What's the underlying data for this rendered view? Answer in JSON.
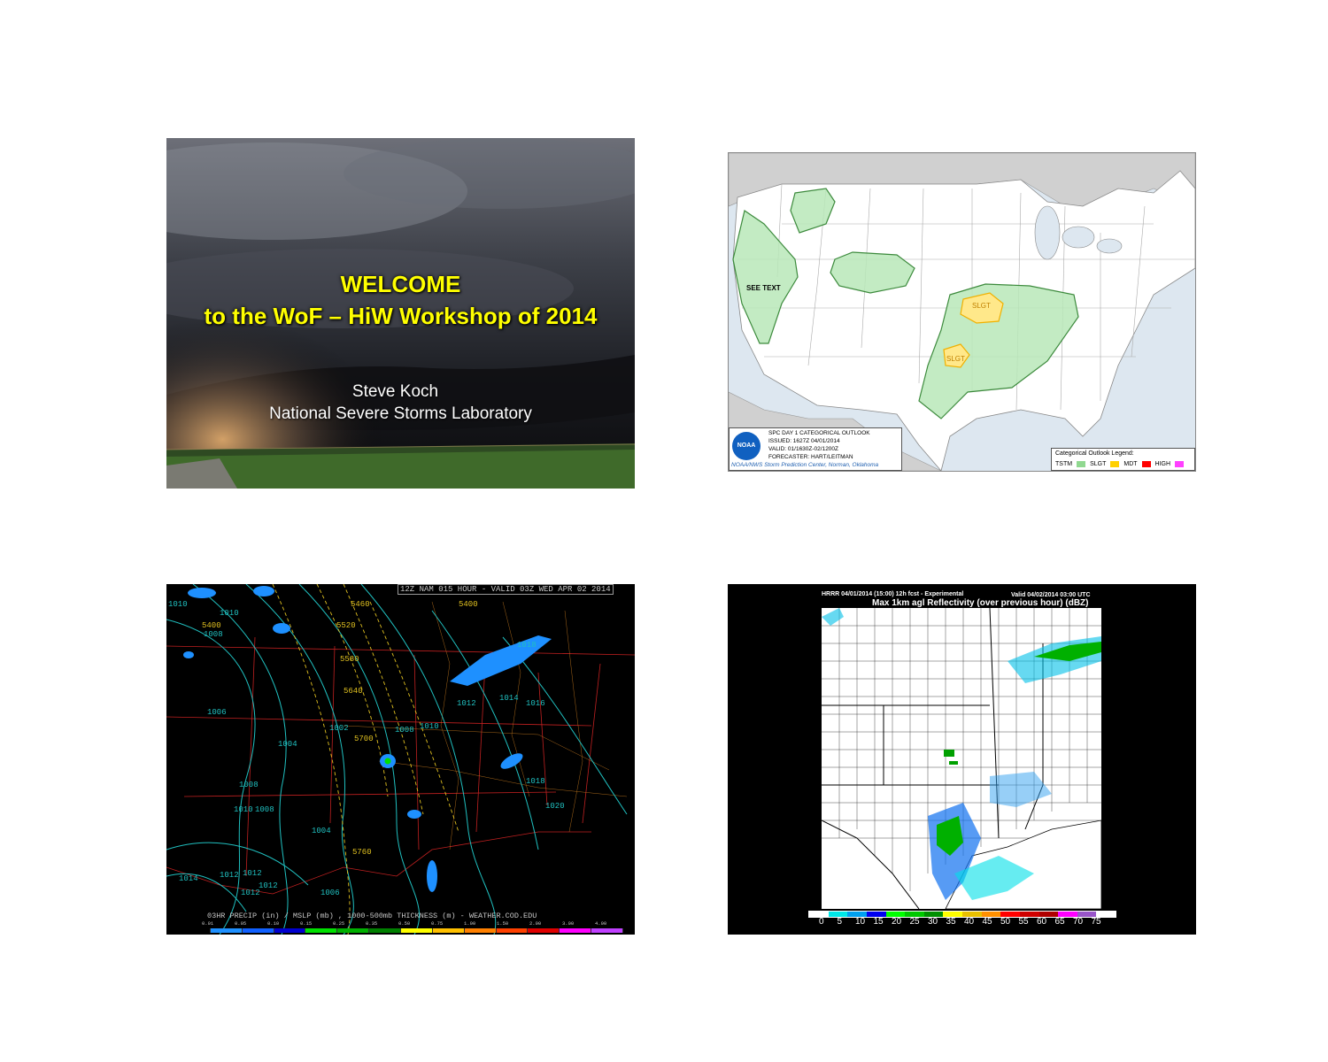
{
  "slide1": {
    "title_line1": "WELCOME",
    "title_line2": "to the WoF – HiW Workshop of 2014",
    "presenter": "Steve Koch",
    "affiliation": "National Severe Storms Laboratory"
  },
  "slide2": {
    "see_text": "SEE TEXT",
    "slgt_1": "SLGT",
    "slgt_2": "SLGT",
    "info_line1": "SPC DAY 1 CATEGORICAL OUTLOOK",
    "info_line2": "ISSUED: 1627Z 04/01/2014",
    "info_line3": "VALID: 01/1630Z-02/1200Z",
    "info_line4": "FORECASTER: HART/LEITMAN",
    "info_line5": "NOAA/NWS Storm Prediction Center, Norman, Oklahoma",
    "noaa_logo": "NOAA",
    "legend_title": "Categorical Outlook Legend:",
    "legend": [
      {
        "label": "TSTM",
        "color": "#90d890"
      },
      {
        "label": "SLGT",
        "color": "#ffd000"
      },
      {
        "label": "MDT",
        "color": "#ff0000"
      },
      {
        "label": "HIGH",
        "color": "#ff40ff"
      }
    ]
  },
  "slide3": {
    "header": "12Z NAM 015 HOUR - VALID 03Z WED APR 02 2014",
    "footer": "03HR PRECIP (in) / MSLP (mb) , 1000-500mb THICKNESS (m) - WEATHER.COD.EDU",
    "labels": [
      "1010",
      "1010",
      "5400",
      "1008",
      "5460",
      "5400",
      "5520",
      "5580",
      "5640",
      "1018",
      "1006",
      "1002",
      "5700",
      "1004",
      "1008",
      "1010",
      "1012",
      "1014",
      "1016",
      "1008",
      "1010",
      "1008",
      "1004",
      "1018",
      "1020",
      "5760",
      "1014",
      "1012",
      "1012",
      "1012",
      "1006",
      "1012"
    ],
    "scale": [
      "0.01",
      "0.05",
      "0.10",
      "0.15",
      "0.25",
      "0.35",
      "0.50",
      "0.75",
      "1.00",
      "1.50",
      "2.00",
      "3.00",
      "4.00"
    ],
    "scale_colors": [
      "#000000",
      "#1e90ff",
      "#1060ff",
      "#0000d0",
      "#00e000",
      "#00b000",
      "#008000",
      "#ffff00",
      "#ffc000",
      "#ff8000",
      "#ff4000",
      "#e00000",
      "#ff00ff",
      "#c040ff"
    ]
  },
  "slide4": {
    "header_left": "HRRR 04/01/2014 (15:00) 12h fcst - Experimental",
    "header_right": "Valid 04/02/2014 03:00 UTC",
    "title": "Max 1km agl Reflectivity (over previous hour) (dBZ)",
    "scale": [
      "0",
      "5",
      "10",
      "15",
      "20",
      "25",
      "30",
      "35",
      "40",
      "45",
      "50",
      "55",
      "60",
      "65",
      "70",
      "75"
    ],
    "scale_colors": [
      "#ffffff",
      "#00e8e8",
      "#00a0f0",
      "#0000f0",
      "#00ff00",
      "#00c800",
      "#009000",
      "#ffff00",
      "#e8c000",
      "#ff9000",
      "#ff0000",
      "#d00000",
      "#b00000",
      "#ff00ff",
      "#9955c9",
      "#ffffff"
    ]
  }
}
